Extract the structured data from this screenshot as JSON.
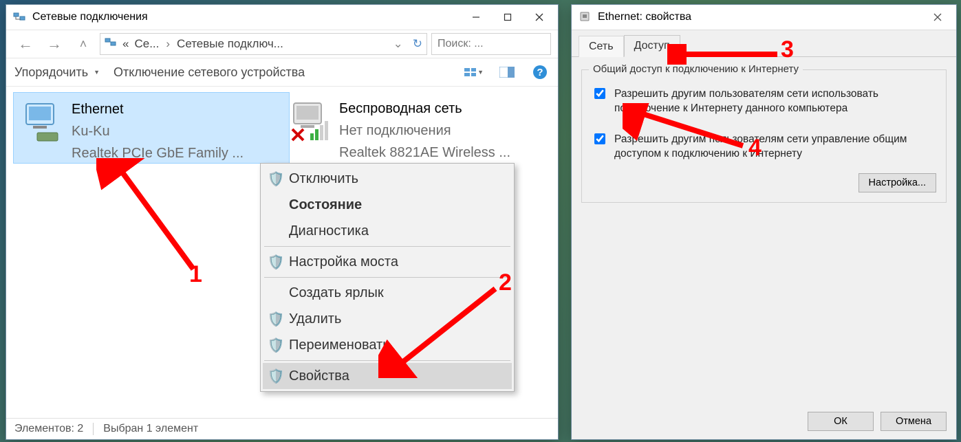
{
  "win1": {
    "title": "Сетевые подключения",
    "breadcrumb": {
      "ellipsis": "«",
      "part1": "Се...",
      "part2": "Сетевые подключ..."
    },
    "search_placeholder": "Поиск: ...",
    "cmd_organize": "Упорядочить",
    "cmd_disable": "Отключение сетевого устройства",
    "connections": [
      {
        "name": "Ethernet",
        "status": "Ku-Ku",
        "adapter": "Realtek PCIe GbE Family ..."
      },
      {
        "name": "Беспроводная сеть",
        "status": "Нет подключения",
        "adapter": "Realtek 8821AE Wireless ..."
      }
    ],
    "context_menu": {
      "disable": "Отключить",
      "status": "Состояние",
      "diagnose": "Диагностика",
      "bridge": "Настройка моста",
      "shortcut": "Создать ярлык",
      "delete": "Удалить",
      "rename": "Переименовать",
      "properties": "Свойства"
    },
    "status_items": "Элементов: 2",
    "status_selected": "Выбран 1 элемент"
  },
  "win2": {
    "title": "Ethernet: свойства",
    "tab_network": "Сеть",
    "tab_sharing": "Доступ",
    "group_title": "Общий доступ к подключению к Интернету",
    "chk1": "Разрешить другим пользователям сети использовать подключение к Интернету данного компьютера",
    "chk2": "Разрешить другим пользователям сети управление общим доступом к подключению к Интернету",
    "btn_settings": "Настройка...",
    "btn_ok": "ОК",
    "btn_cancel": "Отмена"
  },
  "annotations": {
    "n1": "1",
    "n2": "2",
    "n3": "3",
    "n4": "4"
  }
}
